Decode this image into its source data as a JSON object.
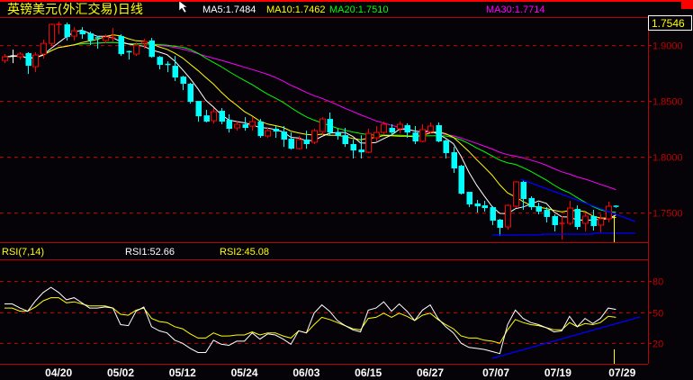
{
  "header": {
    "title": "英镑美元(外汇交易)日线",
    "ma5_label": "MA5:1.7484",
    "ma10_label": "MA10:1.7462",
    "ma20_label": "MA20:1.7510",
    "ma30_label": "MA30:1.7714",
    "current_price": "1.7546"
  },
  "rsi_header": {
    "name": "RSI(7,14)",
    "rsi1_label": "RSI1:52.66",
    "rsi2_label": "RSI2:45.08"
  },
  "colors": {
    "up": "#ff0000",
    "down": "#00ffff",
    "ma5": "#ffffff",
    "ma10": "#ffff00",
    "ma20": "#00ff00",
    "ma30": "#ff00ff",
    "grid": "#c00000",
    "trendline": "#0000ff"
  },
  "chart_data": [
    {
      "type": "candlestick",
      "title": "英镑美元(外汇交易)日线",
      "ylim": [
        1.725,
        1.925
      ],
      "y_ticks": [
        "1.9000",
        "1.8500",
        "1.8000",
        "1.7500"
      ],
      "y_tick_values": [
        1.9,
        1.85,
        1.8,
        1.75
      ],
      "x_labels": [
        {
          "index": 7,
          "label": "04/20"
        },
        {
          "index": 15,
          "label": "05/02"
        },
        {
          "index": 23,
          "label": "05/12"
        },
        {
          "index": 31,
          "label": "05/24"
        },
        {
          "index": 39,
          "label": "06/03"
        },
        {
          "index": 47,
          "label": "06/15"
        },
        {
          "index": 55,
          "label": "06/27"
        },
        {
          "index": 63.5,
          "label": "07/07"
        },
        {
          "index": 71.5,
          "label": "07/19"
        },
        {
          "index": 79.8,
          "label": "07/29"
        }
      ],
      "ohlc_format": [
        "open",
        "high",
        "low",
        "close"
      ],
      "candles": [
        [
          1.8862,
          1.8919,
          1.8838,
          1.8894
        ],
        [
          1.8902,
          1.8959,
          1.8838,
          1.8902
        ],
        [
          1.8894,
          1.8935,
          1.887,
          1.8919
        ],
        [
          1.8927,
          1.8935,
          1.8741,
          1.8814
        ],
        [
          1.8806,
          1.8935,
          1.8757,
          1.8911
        ],
        [
          1.8919,
          1.9048,
          1.8878,
          1.9015
        ],
        [
          1.9015,
          1.9193,
          1.8991,
          1.9185
        ],
        [
          1.918,
          1.9209,
          1.9096,
          1.9185
        ],
        [
          1.9185,
          1.9201,
          1.904,
          1.9072
        ],
        [
          1.908,
          1.916,
          1.904,
          1.9128
        ],
        [
          1.9128,
          1.916,
          1.9056,
          1.9096
        ],
        [
          1.9104,
          1.912,
          1.8999,
          1.904
        ],
        [
          1.9064,
          1.908,
          1.8967,
          1.9056
        ],
        [
          1.904,
          1.9096,
          1.9015,
          1.9072
        ],
        [
          1.906,
          1.9152,
          1.9031,
          1.9064
        ],
        [
          1.908,
          1.9096,
          1.8902,
          1.8919
        ],
        [
          1.894,
          1.8951,
          1.887,
          1.8935
        ],
        [
          1.8919,
          1.9023,
          1.8902,
          1.8999
        ],
        [
          1.9015,
          1.9056,
          1.8967,
          1.9031
        ],
        [
          1.904,
          1.9064,
          1.8886,
          1.8894
        ],
        [
          1.8894,
          1.8902,
          1.8782,
          1.8822
        ],
        [
          1.8826,
          1.8854,
          1.8757,
          1.8822
        ],
        [
          1.8814,
          1.8902,
          1.8677,
          1.8709
        ],
        [
          1.8717,
          1.8725,
          1.8596,
          1.8653
        ],
        [
          1.8653,
          1.8661,
          1.8475,
          1.8491
        ],
        [
          1.8499,
          1.8499,
          1.8314,
          1.8362
        ],
        [
          1.837,
          1.8419,
          1.8306,
          1.8314
        ],
        [
          1.8322,
          1.8435,
          1.8298,
          1.8403
        ],
        [
          1.8411,
          1.8435,
          1.829,
          1.8314
        ],
        [
          1.833,
          1.8379,
          1.8217,
          1.825
        ],
        [
          1.8258,
          1.8314,
          1.8233,
          1.829
        ],
        [
          1.829,
          1.8354,
          1.8233,
          1.8258
        ],
        [
          1.8274,
          1.8354,
          1.8233,
          1.8314
        ],
        [
          1.8314,
          1.8338,
          1.8169,
          1.8185
        ],
        [
          1.8185,
          1.8258,
          1.8169,
          1.8233
        ],
        [
          1.825,
          1.8274,
          1.8169,
          1.8225
        ],
        [
          1.8225,
          1.8274,
          1.8088,
          1.8153
        ],
        [
          1.8161,
          1.8217,
          1.8064,
          1.8072
        ],
        [
          1.8072,
          1.8185,
          1.8064,
          1.8153
        ],
        [
          1.8153,
          1.8233,
          1.8072,
          1.8113
        ],
        [
          1.8129,
          1.825,
          1.8113,
          1.8233
        ],
        [
          1.8225,
          1.8354,
          1.8193,
          1.8338
        ],
        [
          1.8338,
          1.8395,
          1.8193,
          1.8217
        ],
        [
          1.8217,
          1.825,
          1.8153,
          1.8185
        ],
        [
          1.8193,
          1.8258,
          1.8088,
          1.8113
        ],
        [
          1.8113,
          1.8153,
          1.7984,
          1.8056
        ],
        [
          1.8064,
          1.8193,
          1.7984,
          1.804
        ],
        [
          1.804,
          1.825,
          1.8032,
          1.8209
        ],
        [
          1.8169,
          1.8274,
          1.8137,
          1.8217
        ],
        [
          1.8217,
          1.8314,
          1.8193,
          1.829
        ],
        [
          1.8258,
          1.829,
          1.8193,
          1.8217
        ],
        [
          1.825,
          1.8314,
          1.8209,
          1.829
        ],
        [
          1.8282,
          1.8298,
          1.8169,
          1.8217
        ],
        [
          1.8217,
          1.8274,
          1.8113,
          1.8137
        ],
        [
          1.8137,
          1.829,
          1.8129,
          1.8242
        ],
        [
          1.8225,
          1.8306,
          1.8209,
          1.8274
        ],
        [
          1.8282,
          1.8306,
          1.8129,
          1.8137
        ],
        [
          1.8145,
          1.8153,
          1.7984,
          1.8032
        ],
        [
          1.804,
          1.8088,
          1.7855,
          1.7895
        ],
        [
          1.7919,
          1.7927,
          1.7661,
          1.7669
        ],
        [
          1.7685,
          1.7685,
          1.7549,
          1.7573
        ],
        [
          1.7581,
          1.7613,
          1.75,
          1.7556
        ],
        [
          1.7564,
          1.7605,
          1.7508,
          1.754
        ],
        [
          1.7548,
          1.7556,
          1.7387,
          1.7427
        ],
        [
          1.7436,
          1.7444,
          1.729,
          1.7363
        ],
        [
          1.7371,
          1.7573,
          1.7347,
          1.7564
        ],
        [
          1.7556,
          1.7782,
          1.754,
          1.7774
        ],
        [
          1.7774,
          1.779,
          1.7524,
          1.7621
        ],
        [
          1.7629,
          1.7645,
          1.7524,
          1.7548
        ],
        [
          1.7556,
          1.7589,
          1.7484,
          1.7508
        ],
        [
          1.7524,
          1.7548,
          1.7411,
          1.746
        ],
        [
          1.7468,
          1.7484,
          1.7331,
          1.7387
        ],
        [
          1.7399,
          1.7468,
          1.7258,
          1.7403
        ],
        [
          1.7403,
          1.7605,
          1.7387,
          1.754
        ],
        [
          1.7532,
          1.7564,
          1.7347,
          1.7371
        ],
        [
          1.7403,
          1.7492,
          1.7331,
          1.7468
        ],
        [
          1.7468,
          1.7524,
          1.7339,
          1.7379
        ],
        [
          1.7387,
          1.7484,
          1.7323,
          1.7444
        ],
        [
          1.7444,
          1.7597,
          1.7411,
          1.7556
        ],
        [
          1.7556,
          1.7564,
          1.754,
          1.7546
        ]
      ],
      "moving_averages": [
        5,
        10,
        20,
        30
      ],
      "trendlines": [
        {
          "name": "upper",
          "points": [
            [
              66.7,
              1.7798
            ],
            [
              81.5,
              1.7419
            ]
          ]
        },
        {
          "name": "lower",
          "points": [
            [
              63,
              1.7298
            ],
            [
              69.5,
              1.73
            ],
            [
              69.5,
              1.7306
            ],
            [
              76,
              1.7306
            ],
            [
              76,
              1.7315
            ],
            [
              81.5,
              1.7315
            ]
          ]
        }
      ],
      "marker_index": 78.7
    },
    {
      "type": "line",
      "title": "RSI(7,14)",
      "ylim": [
        0,
        100
      ],
      "y_ticks": [
        "80",
        "50",
        "20"
      ],
      "y_tick_values": [
        80,
        50,
        20
      ],
      "series": [
        {
          "name": "RSI1",
          "values": [
            58,
            58,
            54,
            51,
            61,
            69,
            74,
            69,
            62,
            64,
            59,
            54,
            54,
            55,
            54,
            38,
            37,
            51,
            55,
            36,
            32,
            30,
            23,
            20,
            15,
            11,
            11,
            23,
            19,
            18,
            22,
            22,
            30,
            24,
            29,
            28,
            24,
            19,
            32,
            30,
            49,
            57,
            51,
            42,
            37,
            33,
            31,
            52,
            54,
            60,
            51,
            58,
            51,
            42,
            52,
            57,
            44,
            36,
            30,
            20,
            16,
            15,
            14,
            12,
            10,
            38,
            52,
            44,
            40,
            38,
            35,
            31,
            32,
            46,
            36,
            44,
            39,
            44,
            54,
            52.66
          ]
        },
        {
          "name": "RSI2",
          "values": [
            54,
            54,
            51,
            51,
            55,
            61,
            64,
            64,
            59,
            60,
            58,
            56,
            56,
            56,
            54,
            48,
            47,
            52,
            54,
            44,
            41,
            40,
            36,
            34,
            29,
            25,
            25,
            30,
            27,
            27,
            28,
            28,
            31,
            28,
            30,
            30,
            27,
            25,
            32,
            30,
            38,
            45,
            43,
            40,
            37,
            34,
            33,
            44,
            45,
            49,
            45,
            49,
            46,
            42,
            47,
            49,
            43,
            38,
            34,
            27,
            25,
            25,
            23,
            22,
            20,
            33,
            43,
            40,
            38,
            37,
            35,
            33,
            33,
            40,
            36,
            39,
            38,
            40,
            46,
            45.08
          ]
        }
      ],
      "trendline": {
        "points": [
          [
            63,
            5.4
          ],
          [
            82.1,
            45.4
          ]
        ]
      },
      "marker_index": 78.7
    }
  ]
}
